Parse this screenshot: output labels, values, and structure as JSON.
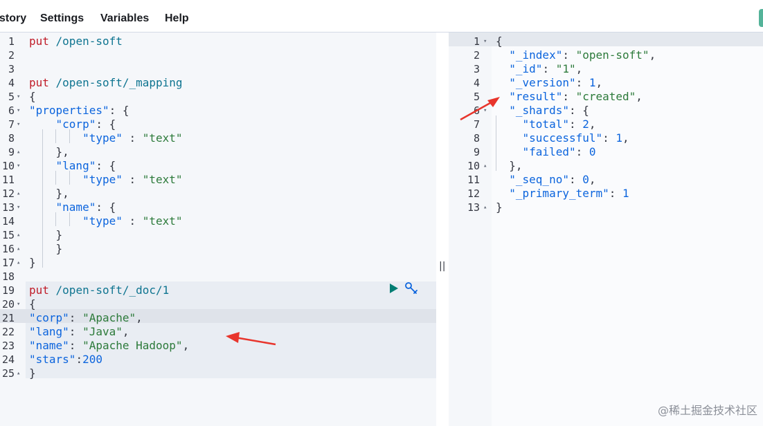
{
  "menu": {
    "history": "story",
    "settings": "Settings",
    "variables": "Variables",
    "help": "Help"
  },
  "left_editor": {
    "lines": [
      {
        "n": "1",
        "fold": "",
        "html": [
          {
            "c": "kw-method",
            "t": "put"
          },
          {
            "c": "kw-url",
            "t": " /open-soft"
          }
        ]
      },
      {
        "n": "2",
        "fold": "",
        "html": []
      },
      {
        "n": "3",
        "fold": "",
        "html": []
      },
      {
        "n": "4",
        "fold": "",
        "html": [
          {
            "c": "kw-method",
            "t": "put"
          },
          {
            "c": "kw-url",
            "t": " /open-soft/_mapping"
          }
        ]
      },
      {
        "n": "5",
        "fold": "down",
        "html": [
          {
            "c": "punc",
            "t": "{"
          }
        ]
      },
      {
        "n": "6",
        "fold": "down",
        "html": [
          {
            "c": "str-key",
            "t": "\"properties\""
          },
          {
            "c": "punc",
            "t": ": {"
          }
        ]
      },
      {
        "n": "7",
        "fold": "down",
        "html": [
          {
            "c": "punc",
            "t": "    "
          },
          {
            "c": "str-key",
            "t": "\"corp\""
          },
          {
            "c": "punc",
            "t": ": {"
          }
        ]
      },
      {
        "n": "8",
        "fold": "",
        "html": [
          {
            "c": "punc",
            "t": "        "
          },
          {
            "c": "str-key",
            "t": "\"type\""
          },
          {
            "c": "punc",
            "t": " : "
          },
          {
            "c": "str",
            "t": "\"text\""
          }
        ]
      },
      {
        "n": "9",
        "fold": "up",
        "html": [
          {
            "c": "punc",
            "t": "    },"
          }
        ]
      },
      {
        "n": "10",
        "fold": "down",
        "html": [
          {
            "c": "punc",
            "t": "    "
          },
          {
            "c": "str-key",
            "t": "\"lang\""
          },
          {
            "c": "punc",
            "t": ": {"
          }
        ]
      },
      {
        "n": "11",
        "fold": "",
        "html": [
          {
            "c": "punc",
            "t": "        "
          },
          {
            "c": "str-key",
            "t": "\"type\""
          },
          {
            "c": "punc",
            "t": " : "
          },
          {
            "c": "str",
            "t": "\"text\""
          }
        ]
      },
      {
        "n": "12",
        "fold": "up",
        "html": [
          {
            "c": "punc",
            "t": "    },"
          }
        ]
      },
      {
        "n": "13",
        "fold": "down",
        "html": [
          {
            "c": "punc",
            "t": "    "
          },
          {
            "c": "str-key",
            "t": "\"name\""
          },
          {
            "c": "punc",
            "t": ": {"
          }
        ]
      },
      {
        "n": "14",
        "fold": "",
        "html": [
          {
            "c": "punc",
            "t": "        "
          },
          {
            "c": "str-key",
            "t": "\"type\""
          },
          {
            "c": "punc",
            "t": " : "
          },
          {
            "c": "str",
            "t": "\"text\""
          }
        ]
      },
      {
        "n": "15",
        "fold": "up",
        "html": [
          {
            "c": "punc",
            "t": "    }"
          }
        ]
      },
      {
        "n": "16",
        "fold": "up",
        "html": [
          {
            "c": "punc",
            "t": "    }"
          }
        ]
      },
      {
        "n": "17",
        "fold": "up",
        "html": [
          {
            "c": "punc",
            "t": "}"
          }
        ]
      },
      {
        "n": "18",
        "fold": "",
        "html": []
      },
      {
        "n": "19",
        "fold": "",
        "html": [
          {
            "c": "kw-method",
            "t": "put"
          },
          {
            "c": "kw-url",
            "t": " /open-soft/_doc/1"
          }
        ]
      },
      {
        "n": "20",
        "fold": "down",
        "html": [
          {
            "c": "punc",
            "t": "{"
          }
        ]
      },
      {
        "n": "21",
        "fold": "",
        "html": [
          {
            "c": "str-key",
            "t": "\"corp\""
          },
          {
            "c": "punc",
            "t": ": "
          },
          {
            "c": "str",
            "t": "\"Apache\""
          },
          {
            "c": "punc",
            "t": ","
          }
        ]
      },
      {
        "n": "22",
        "fold": "",
        "html": [
          {
            "c": "str-key",
            "t": "\"lang\""
          },
          {
            "c": "punc",
            "t": ": "
          },
          {
            "c": "str",
            "t": "\"Java\""
          },
          {
            "c": "punc",
            "t": ","
          }
        ]
      },
      {
        "n": "23",
        "fold": "",
        "html": [
          {
            "c": "str-key",
            "t": "\"name\""
          },
          {
            "c": "punc",
            "t": ": "
          },
          {
            "c": "str",
            "t": "\"Apache Hadoop\""
          },
          {
            "c": "punc",
            "t": ","
          }
        ]
      },
      {
        "n": "24",
        "fold": "",
        "html": [
          {
            "c": "str-key",
            "t": "\"stars\""
          },
          {
            "c": "punc",
            "t": ":"
          },
          {
            "c": "num",
            "t": "200"
          }
        ]
      },
      {
        "n": "25",
        "fold": "up",
        "html": [
          {
            "c": "punc",
            "t": "}"
          }
        ]
      }
    ]
  },
  "right_editor": {
    "lines": [
      {
        "n": "1",
        "fold": "down",
        "html": [
          {
            "c": "punc",
            "t": "{"
          }
        ]
      },
      {
        "n": "2",
        "fold": "",
        "html": [
          {
            "c": "punc",
            "t": "  "
          },
          {
            "c": "str-key",
            "t": "\"_index\""
          },
          {
            "c": "punc",
            "t": ": "
          },
          {
            "c": "str",
            "t": "\"open-soft\""
          },
          {
            "c": "punc",
            "t": ","
          }
        ]
      },
      {
        "n": "3",
        "fold": "",
        "html": [
          {
            "c": "punc",
            "t": "  "
          },
          {
            "c": "str-key",
            "t": "\"_id\""
          },
          {
            "c": "punc",
            "t": ": "
          },
          {
            "c": "str",
            "t": "\"1\""
          },
          {
            "c": "punc",
            "t": ","
          }
        ]
      },
      {
        "n": "4",
        "fold": "",
        "html": [
          {
            "c": "punc",
            "t": "  "
          },
          {
            "c": "str-key",
            "t": "\"_version\""
          },
          {
            "c": "punc",
            "t": ": "
          },
          {
            "c": "num",
            "t": "1"
          },
          {
            "c": "punc",
            "t": ","
          }
        ]
      },
      {
        "n": "5",
        "fold": "",
        "html": [
          {
            "c": "punc",
            "t": "  "
          },
          {
            "c": "str-key",
            "t": "\"result\""
          },
          {
            "c": "punc",
            "t": ": "
          },
          {
            "c": "str",
            "t": "\"created\""
          },
          {
            "c": "punc",
            "t": ","
          }
        ]
      },
      {
        "n": "6",
        "fold": "down",
        "html": [
          {
            "c": "punc",
            "t": "  "
          },
          {
            "c": "str-key",
            "t": "\"_shards\""
          },
          {
            "c": "punc",
            "t": ": {"
          }
        ]
      },
      {
        "n": "7",
        "fold": "",
        "html": [
          {
            "c": "punc",
            "t": "    "
          },
          {
            "c": "str-key",
            "t": "\"total\""
          },
          {
            "c": "punc",
            "t": ": "
          },
          {
            "c": "num",
            "t": "2"
          },
          {
            "c": "punc",
            "t": ","
          }
        ]
      },
      {
        "n": "8",
        "fold": "",
        "html": [
          {
            "c": "punc",
            "t": "    "
          },
          {
            "c": "str-key",
            "t": "\"successful\""
          },
          {
            "c": "punc",
            "t": ": "
          },
          {
            "c": "num",
            "t": "1"
          },
          {
            "c": "punc",
            "t": ","
          }
        ]
      },
      {
        "n": "9",
        "fold": "",
        "html": [
          {
            "c": "punc",
            "t": "    "
          },
          {
            "c": "str-key",
            "t": "\"failed\""
          },
          {
            "c": "punc",
            "t": ": "
          },
          {
            "c": "num",
            "t": "0"
          }
        ]
      },
      {
        "n": "10",
        "fold": "up",
        "html": [
          {
            "c": "punc",
            "t": "  },"
          }
        ]
      },
      {
        "n": "11",
        "fold": "",
        "html": [
          {
            "c": "punc",
            "t": "  "
          },
          {
            "c": "str-key",
            "t": "\"_seq_no\""
          },
          {
            "c": "punc",
            "t": ": "
          },
          {
            "c": "num",
            "t": "0"
          },
          {
            "c": "punc",
            "t": ","
          }
        ]
      },
      {
        "n": "12",
        "fold": "",
        "html": [
          {
            "c": "punc",
            "t": "  "
          },
          {
            "c": "str-key",
            "t": "\"_primary_term\""
          },
          {
            "c": "punc",
            "t": ": "
          },
          {
            "c": "num",
            "t": "1"
          }
        ]
      },
      {
        "n": "13",
        "fold": "up",
        "html": [
          {
            "c": "punc",
            "t": "}"
          }
        ]
      }
    ]
  },
  "splitter": "||",
  "watermark": "@稀土掘金技术社区",
  "icons": {
    "run": "play-icon",
    "settings": "wrench-icon",
    "fold_open": "caret-down-icon",
    "fold_closed": "caret-up-icon"
  },
  "colors": {
    "method": "#c01c28",
    "url": "#0e7490",
    "key": "#0b64dd",
    "string": "#2c7a3a",
    "number": "#0b64dd",
    "run_button": "#017d73",
    "annotation_arrow": "#e8352c"
  }
}
